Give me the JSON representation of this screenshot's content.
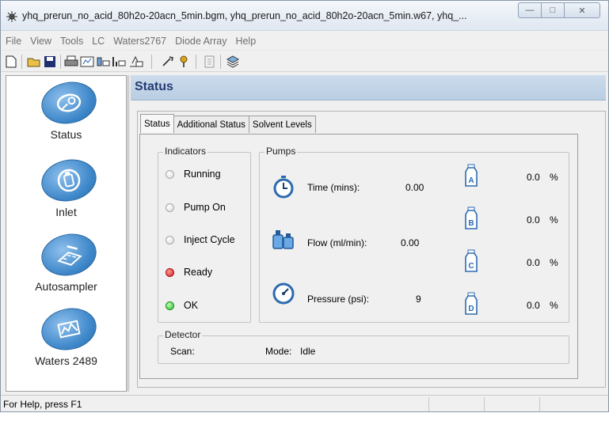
{
  "window": {
    "title": "yhq_prerun_no_acid_80h2o-20acn_5min.bgm, yhq_prerun_no_acid_80h2o-20acn_5min.w67, yhq_..."
  },
  "menu": [
    "File",
    "View",
    "Tools",
    "LC",
    "Waters2767",
    "Diode Array",
    "Help"
  ],
  "toolbar_icons": [
    "new-icon",
    "open-icon",
    "save-icon",
    "print-icon",
    "lc-status-icon",
    "pump-icon",
    "detector-icon",
    "autosampler-icon",
    "wrench-icon",
    "pin-icon",
    "export-icon",
    "settings-icon"
  ],
  "nav": [
    {
      "label": "Status",
      "icon": "status-gauge-icon"
    },
    {
      "label": "Inlet",
      "icon": "inlet-bottle-icon"
    },
    {
      "label": "Autosampler",
      "icon": "autosampler-tray-icon"
    },
    {
      "label": "Waters 2489",
      "icon": "detector-chart-icon"
    }
  ],
  "header": {
    "title": "Status"
  },
  "tabs": [
    "Status",
    "Additional Status",
    "Solvent Levels"
  ],
  "indicators": {
    "legend": "Indicators",
    "items": [
      {
        "label": "Running",
        "state": "off"
      },
      {
        "label": "Pump On",
        "state": "off"
      },
      {
        "label": "Inject Cycle",
        "state": "off"
      },
      {
        "label": "Ready",
        "state": "red"
      },
      {
        "label": "OK",
        "state": "green"
      }
    ]
  },
  "pumps": {
    "legend": "Pumps",
    "time_label": "Time (mins):",
    "time_value": "0.00",
    "flow_label": "Flow (ml/min):",
    "flow_value": "0.00",
    "pressure_label": "Pressure (psi):",
    "pressure_value": "9",
    "solvents": [
      {
        "name": "A",
        "value": "0.0",
        "unit": "%"
      },
      {
        "name": "B",
        "value": "0.0",
        "unit": "%"
      },
      {
        "name": "C",
        "value": "0.0",
        "unit": "%"
      },
      {
        "name": "D",
        "value": "0.0",
        "unit": "%"
      }
    ]
  },
  "detector": {
    "legend": "Detector",
    "scan_label": "Scan:",
    "mode_label": "Mode:",
    "mode_value": "Idle"
  },
  "status_bar": {
    "text": "For Help, press F1"
  },
  "colors": {
    "header_text": "#243c73",
    "nav_badge": "#3c86c9",
    "led_red": "#d21f1f",
    "led_green": "#2fbf2f"
  }
}
